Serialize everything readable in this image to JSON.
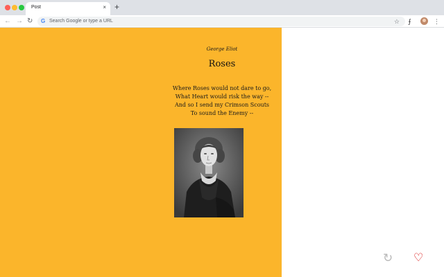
{
  "browser": {
    "tab_title": "Post",
    "tab_close": "×",
    "new_tab": "+",
    "omnibox_placeholder": "Search Google or type a URL",
    "back": "←",
    "forward": "→",
    "reload": "↻",
    "star": "☆",
    "menu": "⋮",
    "extension": "⨍"
  },
  "post": {
    "author": "George Eliot",
    "title": "Roses",
    "poem_lines": [
      "Where Roses would not dare to go,",
      "What Heart would risk the way --",
      "And so I send my Crimson Scouts",
      "To sound the Enemy --"
    ]
  },
  "actions": {
    "reload_icon": "↻",
    "heart_icon": "♡"
  },
  "colors": {
    "panel": "#fbb52b",
    "heart": "#d40000",
    "reload": "#b8b8b8"
  }
}
